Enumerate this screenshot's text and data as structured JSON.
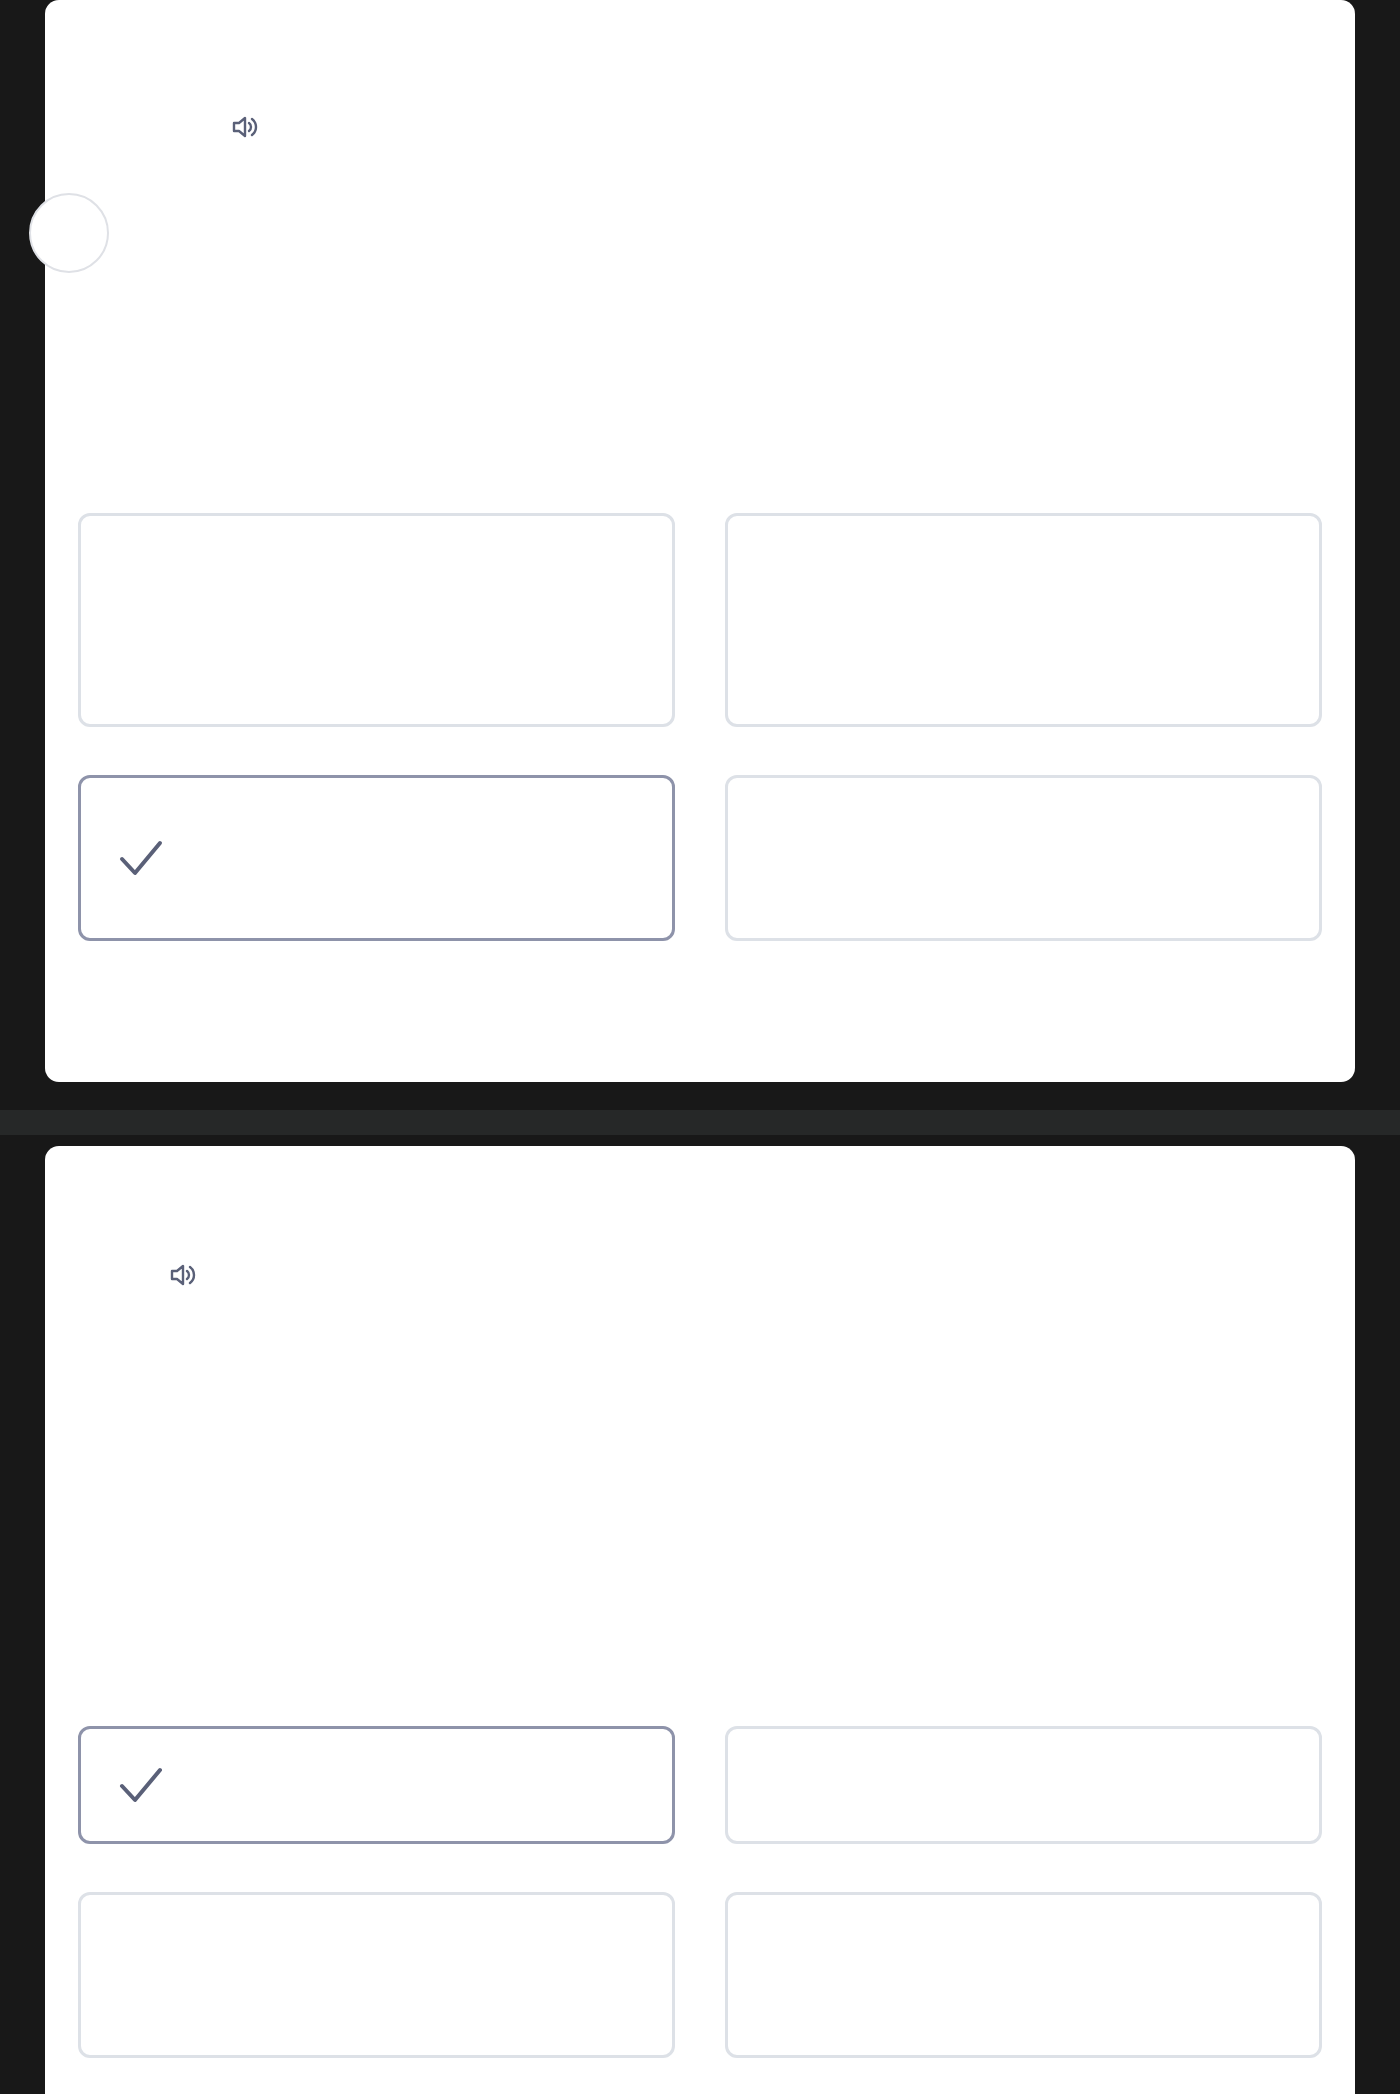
{
  "questions": [
    {
      "options": [
        {
          "selected": false
        },
        {
          "selected": false
        },
        {
          "selected": true
        },
        {
          "selected": false
        }
      ]
    },
    {
      "options": [
        {
          "selected": true
        },
        {
          "selected": false
        },
        {
          "selected": false
        },
        {
          "selected": false
        }
      ]
    }
  ]
}
